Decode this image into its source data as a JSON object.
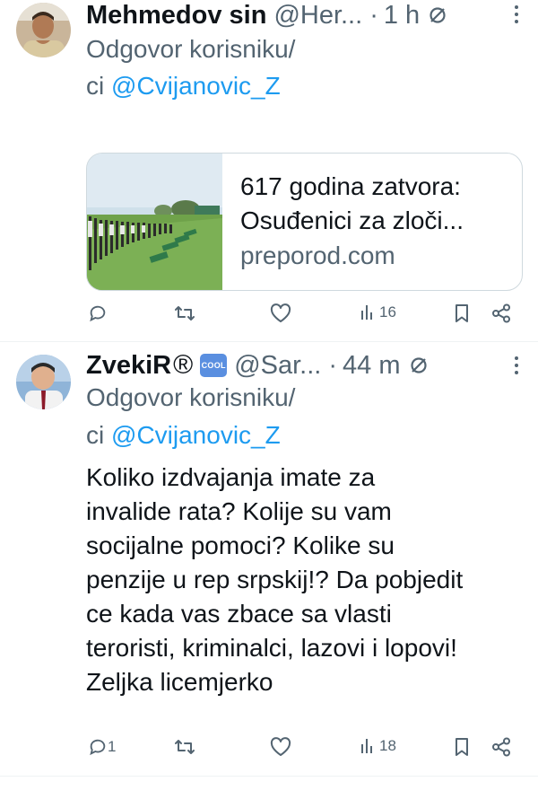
{
  "tweets": [
    {
      "display_name": "Mehmedov sin",
      "handle": "@Her...",
      "sep": "·",
      "time": "1 h",
      "reply_prefix": "Odgovor korisniku/",
      "reply_prefix2": "ci",
      "reply_to": "@Cvijanovic_Z",
      "card": {
        "title_line1": "617 godina zatvora:",
        "title_line2": "Osuđenici za zloči...",
        "domain": "preporod.com"
      },
      "actions": {
        "replies": "",
        "retweets": "",
        "likes": "",
        "views": "16"
      }
    },
    {
      "display_name": "ZvekiR",
      "registered": "®",
      "cool_badge": "COOL",
      "handle": "@Sar...",
      "sep": "·",
      "time": "44 m",
      "reply_prefix": "Odgovor korisniku/",
      "reply_prefix2": "ci",
      "reply_to": "@Cvijanovic_Z",
      "text_lines": [
        "Koliko izdvajanja imate za",
        "invalide rata? Kolije su vam",
        "socijalne pomoci? Kolike su",
        "penzije u rep srpskij!? Da pobjedit",
        "ce kada vas zbace sa vlasti",
        "teroristi, kriminalci, lazovi i lopovi!",
        "Zeljka licemjerko"
      ],
      "actions": {
        "replies": "1",
        "retweets": "",
        "likes": "",
        "views": "18"
      }
    }
  ],
  "colors": {
    "accent": "#1d9bf0",
    "muted": "#536471",
    "text": "#0f1419",
    "border": "#cfd9de"
  },
  "icons": [
    "mute-icon",
    "more-icon",
    "reply-icon",
    "retweet-icon",
    "like-icon",
    "views-icon",
    "bookmark-icon",
    "share-icon"
  ]
}
